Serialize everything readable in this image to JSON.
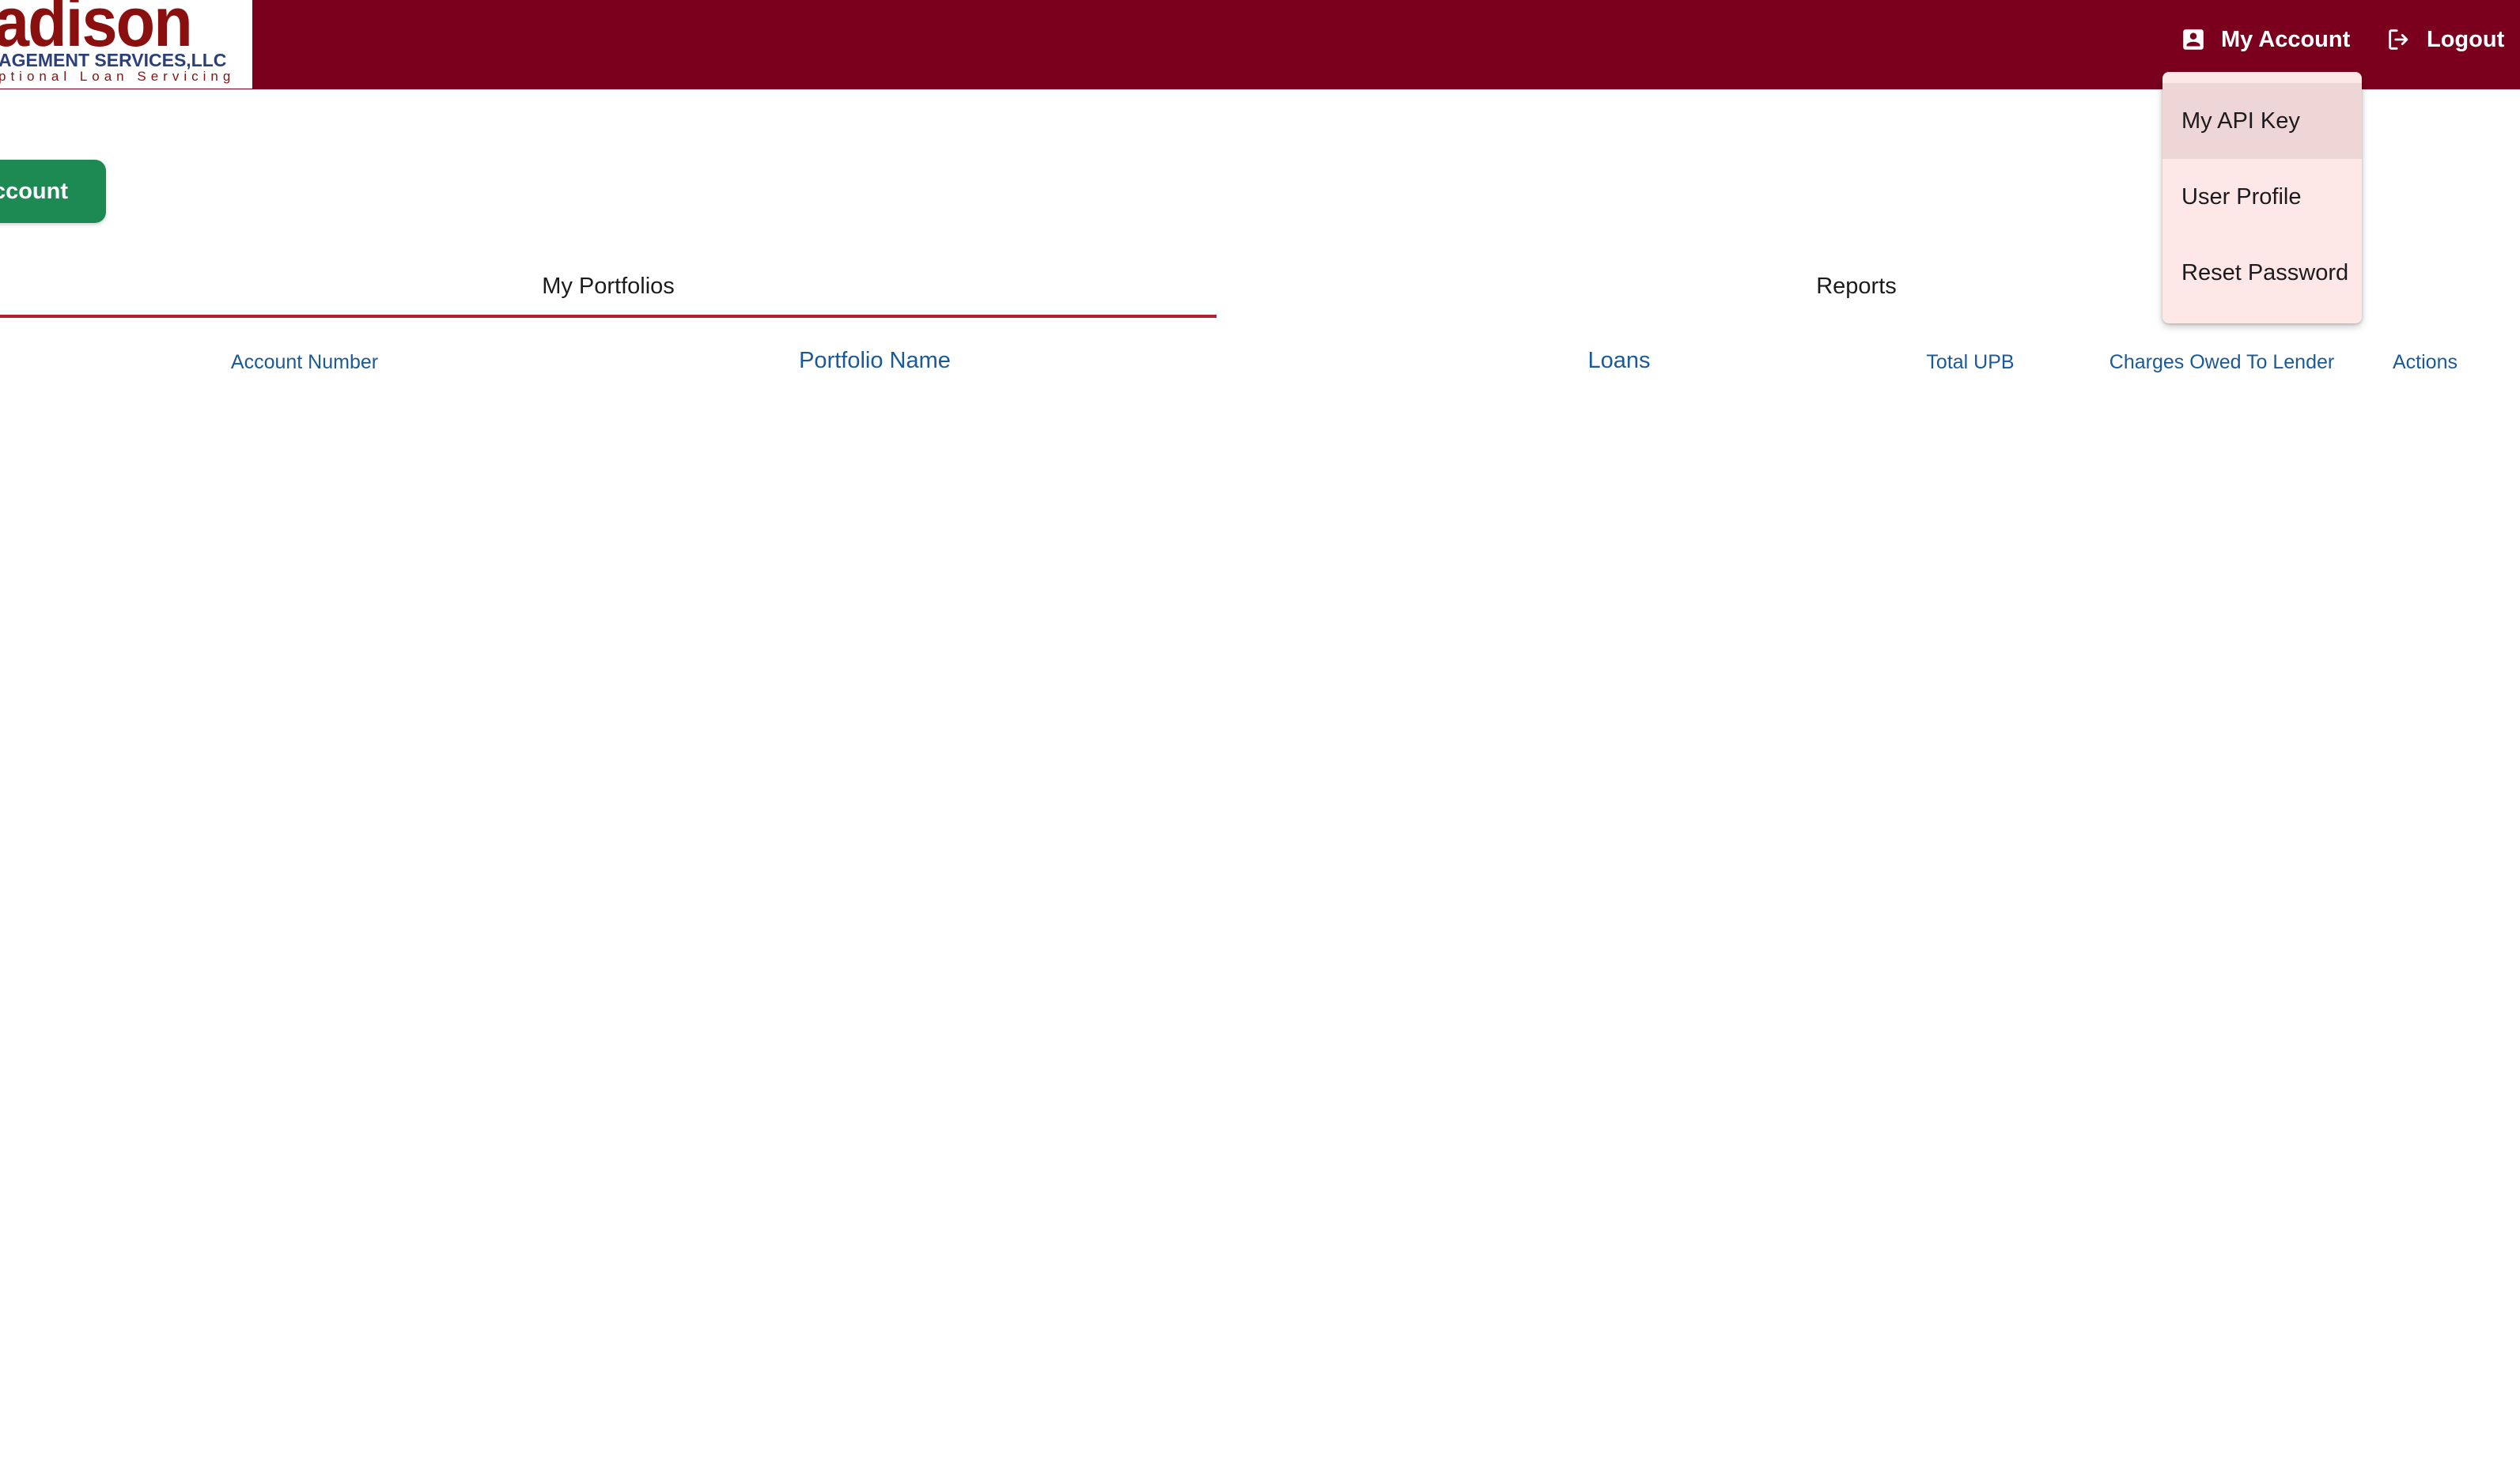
{
  "logo": {
    "word": "adison",
    "line2": "AGEMENT SERVICES,LLC",
    "line3": "ptional Loan Servicing"
  },
  "header": {
    "my_account_label": "My Account",
    "logout_label": "Logout"
  },
  "account_menu": {
    "items": [
      {
        "label": "My API Key",
        "highlighted": true
      },
      {
        "label": "User Profile",
        "highlighted": false
      },
      {
        "label": "Reset Password",
        "highlighted": false
      }
    ]
  },
  "primary_button": {
    "label": "ccount"
  },
  "tabs": [
    {
      "label": "My Portfolios",
      "active": true
    },
    {
      "label": "Reports",
      "active": false
    }
  ],
  "table": {
    "columns": [
      "Account Number",
      "Portfolio Name",
      "Loans",
      "Total UPB",
      "Charges Owed To Lender",
      "Actions"
    ],
    "rows": []
  },
  "colors": {
    "header_bg": "#7a001e",
    "menu_bg": "#fde7e7",
    "menu_active_bg": "#efd6d6",
    "button_green": "#1e8a53",
    "tab_indicator": "#b3202a",
    "column_header_text": "#1a5a96"
  },
  "icons": {
    "account": "account-box-icon",
    "logout": "logout-icon"
  }
}
